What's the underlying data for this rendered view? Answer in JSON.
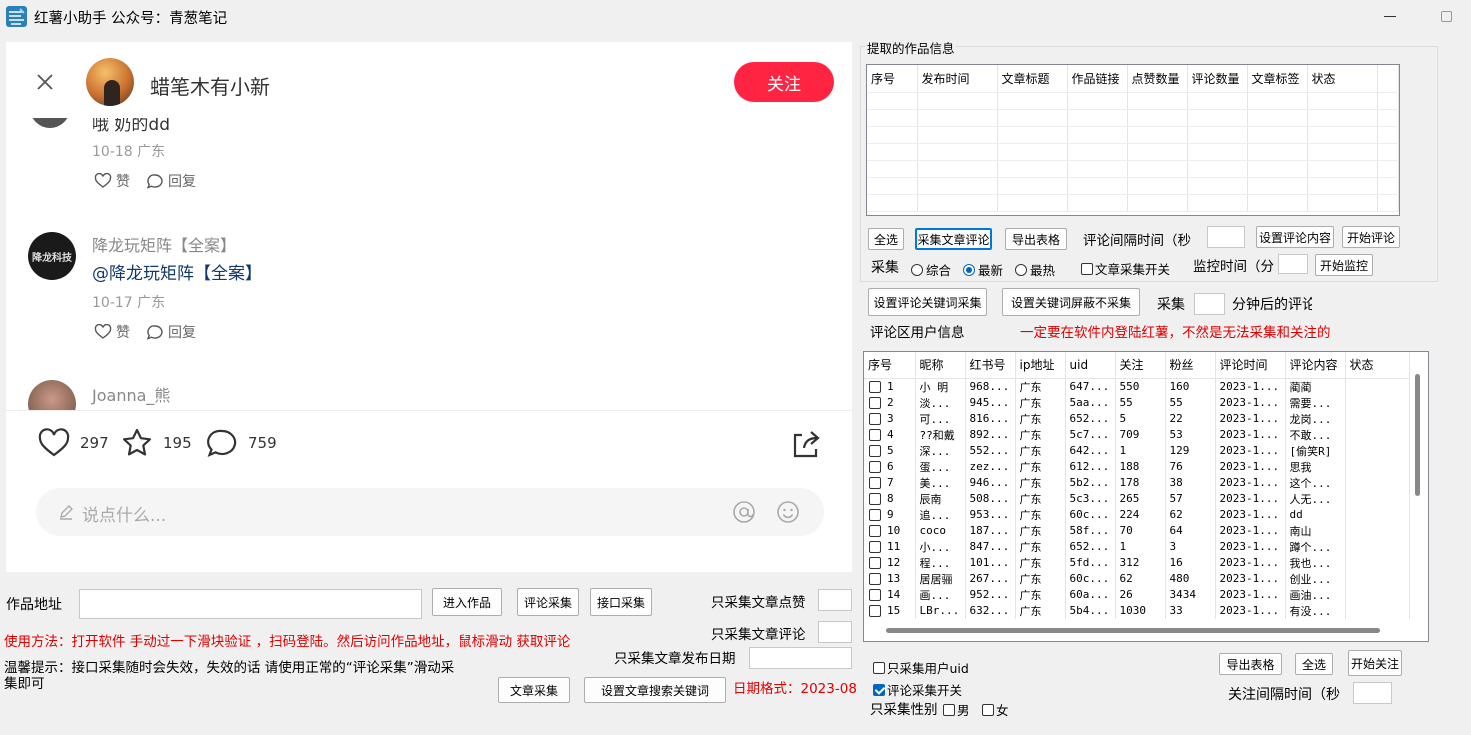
{
  "app": {
    "title": "红薯小助手  公众号：青葱笔记"
  },
  "post": {
    "author": "蜡笔木有小新",
    "follow_label": "关注",
    "partial_comment": "哦 奶的dd",
    "comments": [
      {
        "meta": "10-18 广东",
        "like": "赞",
        "reply": "回复"
      },
      {
        "name": "降龙玩矩阵【全案】",
        "avatar_text": "降龙科技",
        "text": "@降龙玩矩阵【全案】",
        "meta": "10-17 广东",
        "like": "赞",
        "reply": "回复"
      },
      {
        "name": "Joanna_熊"
      }
    ],
    "likes": "297",
    "stars": "195",
    "comments_count": "759",
    "input_placeholder": "说点什么..."
  },
  "bottom": {
    "url_label": "作品地址",
    "enter_btn": "进入作品",
    "comment_collect_btn": "评论采集",
    "api_collect_btn": "接口采集",
    "only_likes": "只采集文章点赞",
    "only_comments": "只采集文章评论",
    "only_date": "只采集文章发布日期",
    "usage": "使用方法：打开软件  手动过一下滑块验证   ，扫码登陆。然后访问作品地址，鼠标滑动  获取评论",
    "tip": "温馨提示：接口采集随时会失效，失效的话  请使用正常的“评论采集”滑动采集即可",
    "article_collect_btn": "文章采集",
    "set_search_kw_btn": "设置文章搜索关键词",
    "date_format": "日期格式：2023-08"
  },
  "works": {
    "group_title": "提取的作品信息",
    "columns": [
      "序号",
      "发布时间",
      "文章标题",
      "作品链接",
      "点赞数量",
      "评论数量",
      "文章标签",
      "状态"
    ],
    "select_all": "全选",
    "collect_btn": "采集文章评论",
    "export_btn": "导出表格",
    "interval_label": "评论间隔时间（秒",
    "set_content_btn": "设置评论内容",
    "start_comment_btn": "开始评论",
    "collect_label": "采集",
    "radios": [
      "综合",
      "最新",
      "最热"
    ],
    "switch_label": "文章采集开关",
    "monitor_label": "监控时间（分",
    "start_monitor_btn": "开始监控"
  },
  "keywords": {
    "set_collect_kw": "设置评论关键词采集",
    "set_block_kw": "设置关键词屏蔽不采集",
    "collect": "采集",
    "after": "分钟后的评论",
    "user_info": "评论区用户信息",
    "warning": "一定要在软件内登陆红薯，不然是无法采集和关注的"
  },
  "comments_table": {
    "columns": [
      "序号",
      "昵称",
      "红书号",
      "ip地址",
      "uid",
      "关注",
      "粉丝",
      "评论时间",
      "评论内容",
      "状态"
    ],
    "rows": [
      [
        "1",
        "小 明",
        "968...",
        "广东",
        "647...",
        "550",
        "160",
        "2023-1...",
        "蔺蔺"
      ],
      [
        "2",
        "淡...",
        "945...",
        "广东",
        "5aa...",
        "55",
        "55",
        "2023-1...",
        "需要..."
      ],
      [
        "3",
        "可...",
        "816...",
        "广东",
        "652...",
        "5",
        "22",
        "2023-1...",
        "龙岗..."
      ],
      [
        "4",
        "??和戴",
        "892...",
        "广东",
        "5c7...",
        "709",
        "53",
        "2023-1...",
        "不敢..."
      ],
      [
        "5",
        "深...",
        "552...",
        "广东",
        "642...",
        "1",
        "129",
        "2023-1...",
        "[偷笑R]"
      ],
      [
        "6",
        "蛋...",
        "zez...",
        "广东",
        "612...",
        "188",
        "76",
        "2023-1...",
        "思我"
      ],
      [
        "7",
        "美...",
        "946...",
        "广东",
        "5b2...",
        "178",
        "38",
        "2023-1...",
        "这个..."
      ],
      [
        "8",
        "辰南",
        "508...",
        "广东",
        "5c3...",
        "265",
        "57",
        "2023-1...",
        "人无..."
      ],
      [
        "9",
        "追...",
        "953...",
        "广东",
        "60c...",
        "224",
        "62",
        "2023-1...",
        "dd"
      ],
      [
        "10",
        "coco",
        "187...",
        "广东",
        "58f...",
        "70",
        "64",
        "2023-1...",
        "南山"
      ],
      [
        "11",
        "小...",
        "847...",
        "广东",
        "652...",
        "1",
        "3",
        "2023-1...",
        "蹲个..."
      ],
      [
        "12",
        "程...",
        "101...",
        "广东",
        "5fd...",
        "312",
        "16",
        "2023-1...",
        "我也..."
      ],
      [
        "13",
        "居居骊",
        "267...",
        "广东",
        "60c...",
        "62",
        "480",
        "2023-1...",
        "创业..."
      ],
      [
        "14",
        "画...",
        "952...",
        "广东",
        "60a...",
        "26",
        "3434",
        "2023-1...",
        "画油..."
      ],
      [
        "15",
        "LBr...",
        "632...",
        "广东",
        "5b4...",
        "1030",
        "33",
        "2023-1...",
        "有没..."
      ]
    ],
    "only_uid": "只采集用户uid",
    "comment_switch": "评论采集开关",
    "gender_label": "只采集性别",
    "male": "男",
    "female": "女",
    "export_btn": "导出表格",
    "select_all": "全选",
    "start_follow_btn": "开始关注",
    "follow_interval": "关注间隔时间（秒"
  }
}
